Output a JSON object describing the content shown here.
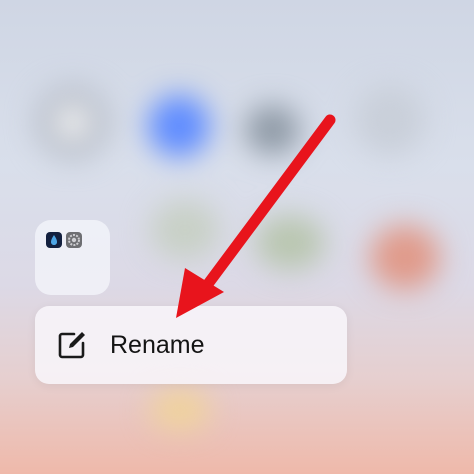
{
  "context_menu": {
    "rename_label": "Rename",
    "rename_icon": "edit-icon"
  },
  "folder": {
    "mini_icons": [
      "app-icon",
      "settings-icon"
    ]
  },
  "annotation": {
    "arrow_color": "#e8141c"
  }
}
